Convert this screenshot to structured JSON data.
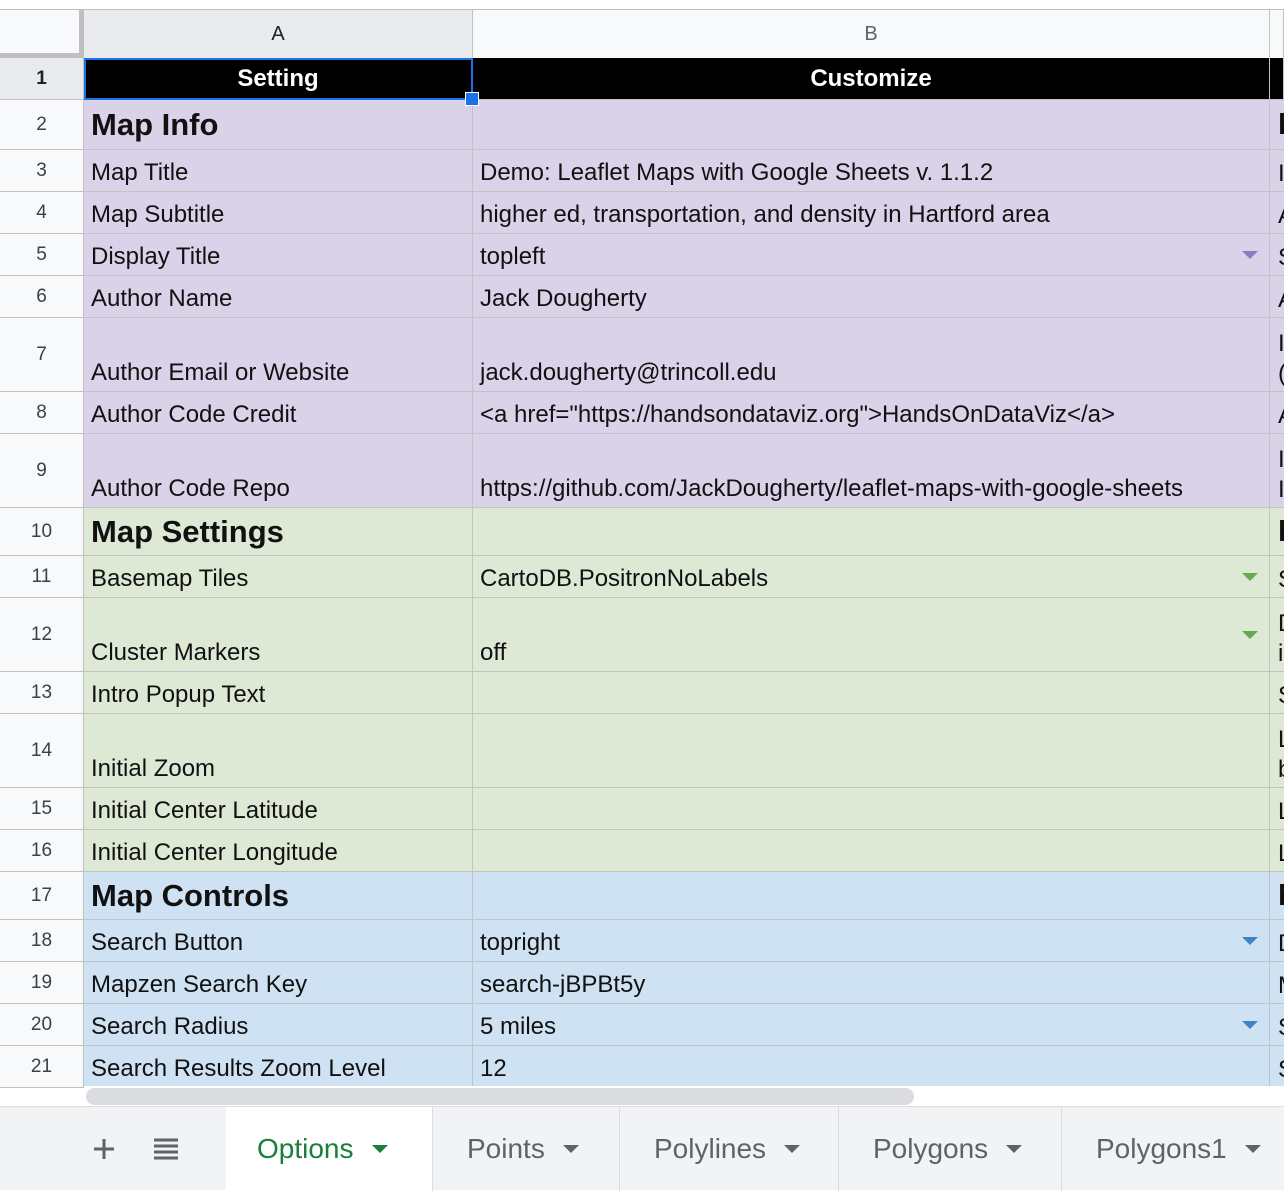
{
  "columns": [
    {
      "letter": "A"
    },
    {
      "letter": "B"
    }
  ],
  "header_row": {
    "num": "1",
    "a": "Setting",
    "b": "Customize"
  },
  "rows": [
    {
      "num": "2",
      "a": "Map Info",
      "b": "",
      "c": [
        "M"
      ],
      "section": true,
      "color": "purple"
    },
    {
      "num": "3",
      "a": "Map Title",
      "b": "Demo: Leaflet Maps with Google Sheets v. 1.1.2",
      "c": [
        "I"
      ],
      "color": "purple"
    },
    {
      "num": "4",
      "a": "Map Subtitle",
      "b": "higher ed, transportation, and density in Hartford area",
      "c": [
        "A"
      ],
      "color": "purple"
    },
    {
      "num": "5",
      "a": "Display Title",
      "b": "topleft",
      "c": [
        "S"
      ],
      "color": "purple",
      "dropdown": true
    },
    {
      "num": "6",
      "a": "Author Name",
      "b": "Jack Dougherty",
      "c": [
        "A"
      ],
      "color": "purple"
    },
    {
      "num": "7",
      "a": "Author Email or Website",
      "b": "jack.dougherty@trincoll.edu",
      "c": [
        "I",
        "("
      ],
      "color": "purple"
    },
    {
      "num": "8",
      "a": "Author Code Credit",
      "b": "<a href=\"https://handsondataviz.org\">HandsOnDataViz</a>",
      "c": [
        "A"
      ],
      "color": "purple"
    },
    {
      "num": "9",
      "a": "Author Code Repo",
      "b": "https://github.com/JackDougherty/leaflet-maps-with-google-sheets",
      "c": [
        "I",
        "I"
      ],
      "color": "purple"
    },
    {
      "num": "10",
      "a": "Map Settings",
      "b": "",
      "c": [
        "M"
      ],
      "section": true,
      "color": "green"
    },
    {
      "num": "11",
      "a": "Basemap Tiles",
      "b": "CartoDB.PositronNoLabels",
      "c": [
        "S"
      ],
      "color": "green",
      "dropdown": true
    },
    {
      "num": "12",
      "a": "Cluster Markers",
      "b": "off",
      "c": [
        "D",
        "i"
      ],
      "color": "green",
      "dropdown": true
    },
    {
      "num": "13",
      "a": "Intro Popup Text",
      "b": "",
      "c": [
        "S"
      ],
      "color": "green"
    },
    {
      "num": "14",
      "a": "Initial Zoom",
      "b": "",
      "c": [
        "L",
        "b"
      ],
      "color": "green"
    },
    {
      "num": "15",
      "a": "Initial Center Latitude",
      "b": "",
      "c": [
        "L"
      ],
      "color": "green"
    },
    {
      "num": "16",
      "a": "Initial Center Longitude",
      "b": "",
      "c": [
        "L"
      ],
      "color": "green"
    },
    {
      "num": "17",
      "a": "Map Controls",
      "b": "",
      "c": [
        "M"
      ],
      "section": true,
      "color": "blue"
    },
    {
      "num": "18",
      "a": "Search Button",
      "b": "topright",
      "c": [
        "D"
      ],
      "color": "blue",
      "dropdown": true
    },
    {
      "num": "19",
      "a": "Mapzen Search Key",
      "b": "search-jBPBt5y",
      "c": [
        "M"
      ],
      "color": "blue"
    },
    {
      "num": "20",
      "a": "Search Radius",
      "b": "5 miles",
      "c": [
        "S"
      ],
      "color": "blue",
      "dropdown": true
    },
    {
      "num": "21",
      "a": "Search Results Zoom Level",
      "b": "12",
      "c": [
        "S"
      ],
      "color": "blue"
    }
  ],
  "tabs": [
    {
      "label": "Options",
      "active": true
    },
    {
      "label": "Points",
      "active": false
    },
    {
      "label": "Polylines",
      "active": false
    },
    {
      "label": "Polygons",
      "active": false
    },
    {
      "label": "Polygons1",
      "active": false
    }
  ],
  "tab_icons": [
    "add-sheet-icon",
    "all-sheets-icon"
  ],
  "colors": {
    "purple": "#d9d2e9",
    "green": "#dde8d5",
    "blue": "#cfe2f3",
    "dropdown_purple": "#8e7cc3",
    "dropdown_green": "#6aa84f",
    "dropdown_blue": "#3d85c6",
    "selection": "#1a73e8",
    "active_tab": "#188038"
  }
}
